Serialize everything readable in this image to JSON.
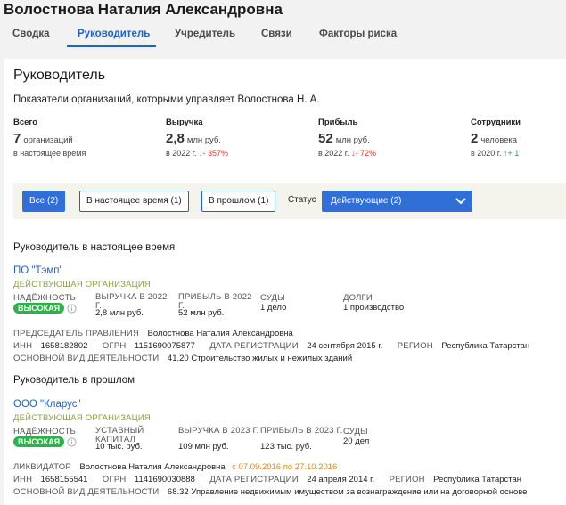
{
  "page": {
    "title": "Волостнова Наталия Александровна"
  },
  "tabs": [
    {
      "label": "Сводка"
    },
    {
      "label": "Руководитель"
    },
    {
      "label": "Учредитель"
    },
    {
      "label": "Связи"
    },
    {
      "label": "Факторы риска"
    }
  ],
  "card": {
    "title": "Руководитель",
    "subtitle": "Показатели организаций, которыми управляет Волостнова Н. А."
  },
  "stats": [
    {
      "label": "Всего",
      "value": "7",
      "unit": "организаций",
      "sub": "в настоящее время",
      "delta": "",
      "direction": ""
    },
    {
      "label": "Выручка",
      "value": "2,8",
      "unit": "млн руб.",
      "sub": "в 2022 г.",
      "delta": "- 357%",
      "direction": "down"
    },
    {
      "label": "Прибыль",
      "value": "52",
      "unit": "млн руб.",
      "sub": "в 2022 г.",
      "delta": "- 72%",
      "direction": "down"
    },
    {
      "label": "Сотрудники",
      "value": "2",
      "unit": "человека",
      "sub": "в 2020 г.",
      "delta": "+ 1",
      "direction": "up"
    }
  ],
  "filters": {
    "all": "Все (2)",
    "current": "В настоящее время (1)",
    "past": "В прошлом (1)",
    "status_label": "Статус",
    "status_value": "Действующие (2)"
  },
  "current_section": {
    "title": "Руководитель в настоящее время",
    "org": {
      "name": "ПО \"Тэмп\"",
      "status": "ДЕЙСТВУЮЩАЯ ОРГАНИЗАЦИЯ",
      "reliability_label": "НАДЁЖНОСТЬ",
      "reliability_value": "ВЫСОКАЯ",
      "revenue_label": "ВЫРУЧКА В 2022 Г.",
      "revenue_value": "2,8 млн руб.",
      "profit_label": "ПРИБЫЛЬ В 2022 Г.",
      "profit_value": "52 млн руб.",
      "courts_label": "СУДЫ",
      "courts_value": "1 дело",
      "debts_label": "ДОЛГИ",
      "debts_value": "1 производство",
      "chair_label": "ПРЕДСЕДАТЕЛЬ ПРАВЛЕНИЯ",
      "chair_value": "Волостнова Наталия Александровна",
      "inn_label": "ИНН",
      "inn_value": "1658182802",
      "ogrn_label": "ОГРН",
      "ogrn_value": "1151690075877",
      "regdate_label": "ДАТА РЕГИСТРАЦИИ",
      "regdate_value": "24 сентября 2015 г.",
      "region_label": "РЕГИОН",
      "region_value": "Республика Татарстан",
      "activity_label": "ОСНОВНОЙ ВИД ДЕЯТЕЛЬНОСТИ",
      "activity_value": "41.20 Строительство жилых и нежилых зданий"
    }
  },
  "past_section": {
    "title": "Руководитель в прошлом",
    "org": {
      "name": "ООО \"Кларус\"",
      "status": "ДЕЙСТВУЮЩАЯ ОРГАНИЗАЦИЯ",
      "reliability_label": "НАДЁЖНОСТЬ",
      "reliability_value": "ВЫСОКАЯ",
      "capital_label": "УСТАВНЫЙ КАПИТАЛ",
      "capital_value": "10 тыс. руб.",
      "revenue_label": "ВЫРУЧКА В 2023 Г.",
      "revenue_value": "109 млн руб.",
      "profit_label": "ПРИБЫЛЬ В 2023 Г.",
      "profit_value": "123 тыс. руб.",
      "courts_label": "СУДЫ",
      "courts_value": "20 дел",
      "liquidator_label": "ЛИКВИДАТОР",
      "liquidator_value": "Волостнова Наталия Александровна",
      "liquidator_period": "с 07.09.2016 по 27.10.2016",
      "inn_label": "ИНН",
      "inn_value": "1658155541",
      "ogrn_label": "ОГРН",
      "ogrn_value": "1141690030888",
      "regdate_label": "ДАТА РЕГИСТРАЦИИ",
      "regdate_value": "24 апреля 2014 г.",
      "region_label": "РЕГИОН",
      "region_value": "Республика Татарстан",
      "activity_label": "ОСНОВНОЙ ВИД ДЕЯТЕЛЬНОСТИ",
      "activity_value": "68.32 Управление недвижимым имуществом за вознаграждение или на договорной основе"
    }
  },
  "colors": {
    "accent": "#2f6fd6",
    "link": "#1f63c6",
    "status_green": "#8aa53a",
    "badge_green": "#2bb34a",
    "down_red": "#e03a2f",
    "up_green": "#26a14f",
    "period_orange": "#e08a1e"
  },
  "icons": {
    "arrow_down": "arrow-down-icon",
    "arrow_up": "arrow-up-icon",
    "info": "info-icon",
    "chevron": "chevron-down-icon"
  }
}
